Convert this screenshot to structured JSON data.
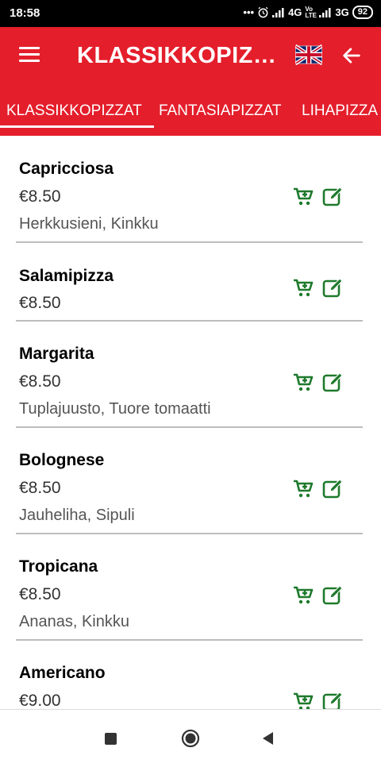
{
  "status": {
    "time": "18:58",
    "net1": "4G",
    "net2": "3G",
    "battery": "92",
    "volte": "Vo LTE"
  },
  "appbar": {
    "title": "KLASSIKKOPIZZ..."
  },
  "tabs": [
    "KLASSIKKOPIZZAT",
    "FANTASIAPIZZAT",
    "LIHAPIZZA"
  ],
  "items": [
    {
      "name": "Capricciosa",
      "price": "€8.50",
      "desc": "Herkkusieni, Kinkku"
    },
    {
      "name": "Salamipizza",
      "price": "€8.50",
      "desc": ""
    },
    {
      "name": "Margarita",
      "price": "€8.50",
      "desc": "Tuplajuusto, Tuore tomaatti"
    },
    {
      "name": "Bolognese",
      "price": "€8.50",
      "desc": "Jauheliha, Sipuli"
    },
    {
      "name": "Tropicana",
      "price": "€8.50",
      "desc": "Ananas, Kinkku"
    },
    {
      "name": "Americano",
      "price": "€9.00",
      "desc": ""
    }
  ],
  "colors": {
    "primary": "#e41e2b",
    "icon_green": "#1e7a2c"
  }
}
